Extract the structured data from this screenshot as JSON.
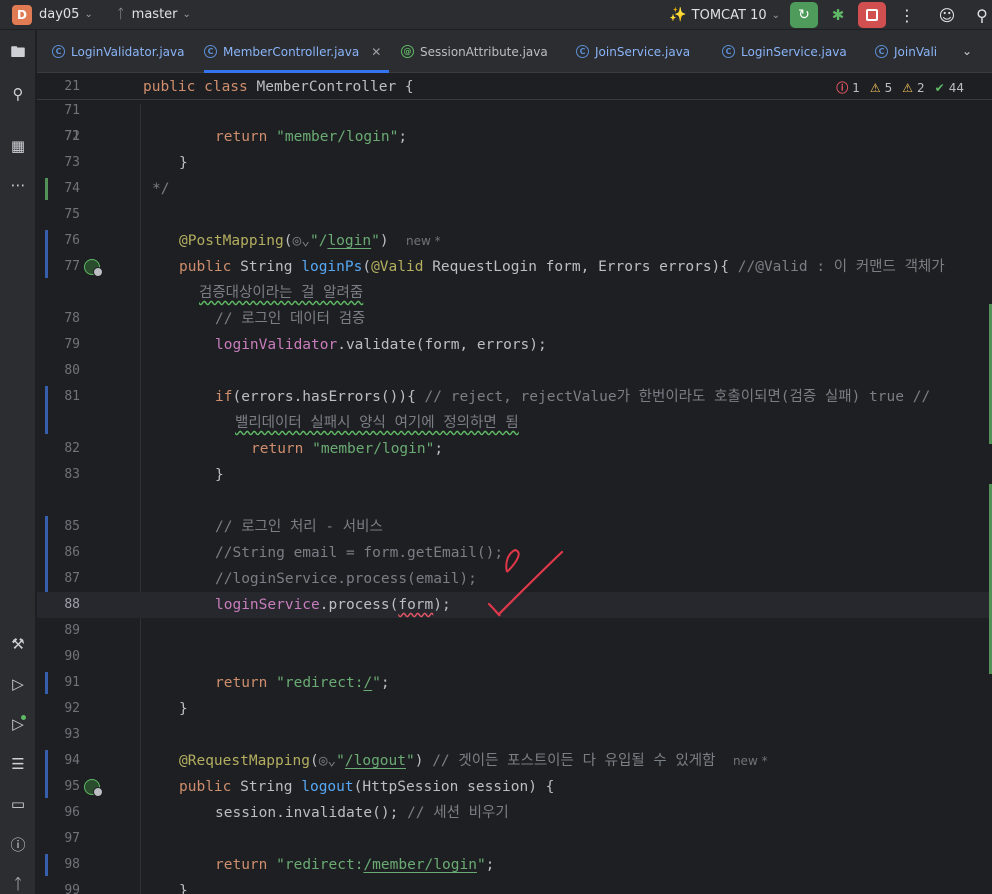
{
  "titlebar": {
    "project_initial": "D",
    "project_name": "day05",
    "branch": "master",
    "run_config": "TOMCAT 10"
  },
  "tabs": [
    {
      "label": "LoginValidator.java",
      "active": false
    },
    {
      "label": "MemberController.java",
      "active": true
    },
    {
      "label": "SessionAttribute.java",
      "active": false
    },
    {
      "label": "JoinService.java",
      "active": false
    },
    {
      "label": "LoginService.java",
      "active": false
    },
    {
      "label": "JoinVali",
      "active": false
    }
  ],
  "inspections": {
    "errors": "1",
    "warnings": "5",
    "weak_warnings": "2",
    "ok": "44"
  },
  "sticky": {
    "line": "21"
  },
  "lines": {
    "l71": "71",
    "l72": "72",
    "l73": "73",
    "l74": "74",
    "l75": "75",
    "l76": "76",
    "l77": "77",
    "l78": "78",
    "l79": "79",
    "l80": "80",
    "l81": "81",
    "l82": "82",
    "l83": "83",
    "l85": "85",
    "l86": "86",
    "l87": "87",
    "l88": "88",
    "l89": "89",
    "l90": "90",
    "l91": "91",
    "l92": "92",
    "l93": "93",
    "l94": "94",
    "l95": "95",
    "l96": "96",
    "l97": "97",
    "l98": "98",
    "l99": "99"
  },
  "code": {
    "hint_new": "new *",
    "c77_comment": "//@Valid : 이 커맨드 객체가",
    "c77_cont": "검증대상이라는 걸 알려줌",
    "c78": "// 로그인 데이터 검증",
    "c81_comment": "// reject, rejectValue가 한번이라도 호출이되면(검증 실패) true //",
    "c81_cont": "밸리데이터 실패시 양식 여기에 정의하면 됨",
    "c85": "// 로그인 처리 - 서비스",
    "c86": "//String email = form.getEmail();",
    "c87": "//loginService.process(email);",
    "c94_comment": "// 겟이든 포스트이든 다 유입될 수 있게함",
    "c96_comment": "// 세션 비우기"
  }
}
